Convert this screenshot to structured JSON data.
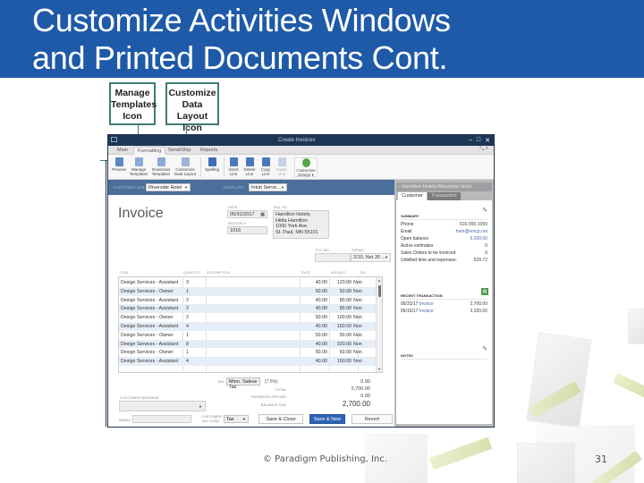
{
  "slide": {
    "title_line1": "Customize Activities Windows",
    "title_line2": "and Printed Documents Cont.",
    "footer": "© Paradigm Publishing, Inc.",
    "page_number": "31",
    "brand_color": "#1f5aa8"
  },
  "callouts": [
    {
      "label_line1": "Manage",
      "label_line2": "Templates",
      "label_line3": "Icon"
    },
    {
      "label_line1": "Customize",
      "label_line2": "Data Layout",
      "label_line3": "Icon"
    }
  ],
  "window": {
    "title": "Create Invoices",
    "controls": [
      "–",
      "□",
      "✕"
    ],
    "tabs": [
      "Main",
      "Formatting",
      "Send/Ship",
      "Reports"
    ],
    "active_tab": "Formatting",
    "ribbon": [
      {
        "label1": "Preview",
        "label2": "",
        "icon": "preview-icon"
      },
      {
        "label1": "Manage",
        "label2": "Templates",
        "icon": "manage-templates-icon"
      },
      {
        "label1": "Download",
        "label2": "Templates",
        "icon": "download-templates-icon"
      },
      {
        "label1": "Customize",
        "label2": "Data Layout",
        "icon": "customize-data-layout-icon"
      },
      {
        "label1": "Spelling",
        "label2": "",
        "icon": "spelling-icon"
      },
      {
        "label1": "Insert",
        "label2": "Line",
        "icon": "insert-line-icon"
      },
      {
        "label1": "Delete",
        "label2": "Line",
        "icon": "delete-line-icon"
      },
      {
        "label1": "Copy",
        "label2": "Line",
        "icon": "copy-line-icon"
      },
      {
        "label1": "Paste",
        "label2": "Line",
        "icon": "paste-line-icon"
      },
      {
        "label1": "Customize",
        "label2": "Design ▾",
        "icon": "customize-design-icon"
      }
    ],
    "customer_job_label": "CUSTOMER:JOB",
    "customer_job_value": "Riverside Hotel",
    "template_label": "TEMPLATE",
    "template_value": "Intuit Servic..."
  },
  "invoice": {
    "heading": "Invoice",
    "date_label": "DATE",
    "date_value": "05/31/2017",
    "invoice_no_label": "INVOICE #",
    "invoice_no_value": "1016",
    "bill_to_label": "BILL TO",
    "bill_to_lines": [
      "Hamilton Hotels",
      "Hilda Hamilton",
      "1000 York Ave.",
      "St. Paul, MN  55101"
    ],
    "po_label": "P.O. NO.",
    "po_value": "",
    "terms_label": "TERMS",
    "terms_value": "2/10, Net 30 ...",
    "columns": [
      "ITEM",
      "QUANTITY",
      "DESCRIPTION",
      "RATE",
      "AMOUNT",
      "TAX"
    ],
    "rows": [
      {
        "item": "Design Services - Assistant",
        "qty": "3",
        "desc": "",
        "rate": "40.00",
        "amount": "120.00",
        "tax": "Non"
      },
      {
        "item": "Design Services - Owner",
        "qty": "1",
        "desc": "",
        "rate": "50.00",
        "amount": "50.00",
        "tax": "Non"
      },
      {
        "item": "Design Services - Assistant",
        "qty": "2",
        "desc": "",
        "rate": "40.00",
        "amount": "80.00",
        "tax": "Non"
      },
      {
        "item": "Design Services - Assistant",
        "qty": "2",
        "desc": "",
        "rate": "40.00",
        "amount": "80.00",
        "tax": "Non"
      },
      {
        "item": "Design Services - Owner",
        "qty": "2",
        "desc": "",
        "rate": "50.00",
        "amount": "100.00",
        "tax": "Non"
      },
      {
        "item": "Design Services - Assistant",
        "qty": "4",
        "desc": "",
        "rate": "40.00",
        "amount": "160.00",
        "tax": "Non"
      },
      {
        "item": "Design Services - Owner",
        "qty": "1",
        "desc": "",
        "rate": "50.00",
        "amount": "50.00",
        "tax": "Non"
      },
      {
        "item": "Design Services - Assistant",
        "qty": "8",
        "desc": "",
        "rate": "40.00",
        "amount": "320.00",
        "tax": "Non"
      },
      {
        "item": "Design Services - Owner",
        "qty": "1",
        "desc": "",
        "rate": "50.00",
        "amount": "50.00",
        "tax": "Non"
      },
      {
        "item": "Design Services - Assistant",
        "qty": "4",
        "desc": "",
        "rate": "40.00",
        "amount": "160.00",
        "tax": "Non"
      }
    ],
    "tax_label": "TAX",
    "tax_item": "Minn. Sales Tax",
    "tax_rate": "(7.6%)",
    "tax_amount": "0.00",
    "total_label": "TOTAL",
    "total_value": "2,700.00",
    "payments_label": "PAYMENTS APPLIED",
    "payments_value": "0.00",
    "balance_label": "BALANCE DUE",
    "balance_value": "2,700.00",
    "customer_message_label": "CUSTOMER MESSAGE",
    "customer_message_value": "",
    "memo_label": "MEMO",
    "memo_value": "",
    "customer_tax_code_label1": "CUSTOMER",
    "customer_tax_code_label2": "TAX CODE",
    "customer_tax_code_value": "Tax",
    "save_close_label": "Save & Close",
    "save_new_label": "Save & New",
    "revert_label": "Revert"
  },
  "side_panel": {
    "header": "Hamilton Hotels:Riverside Hotel",
    "tabs": [
      "Customer",
      "Transaction"
    ],
    "summary_title": "SUMMARY",
    "summary": [
      {
        "label": "Phone",
        "value": "616-555-1050",
        "link": false
      },
      {
        "label": "Email",
        "value": "ham@emcp.net",
        "link": true
      },
      {
        "label": "Open balance",
        "value": "6,020.00",
        "link": true
      },
      {
        "label": "Active estimates",
        "value": "0",
        "link": false
      },
      {
        "label": "Sales Orders to be invoiced",
        "value": "0",
        "link": false
      },
      {
        "label": "Unbilled time and expenses:",
        "value": "529.72",
        "link": false
      }
    ],
    "recent_title": "RECENT TRANSACTION",
    "recent": [
      {
        "date": "05/31/17",
        "type": "Invoice",
        "amount": "2,700.00"
      },
      {
        "date": "05/15/17",
        "type": "Invoice",
        "amount": "3,320.00"
      }
    ],
    "notes_title": "NOTES"
  }
}
